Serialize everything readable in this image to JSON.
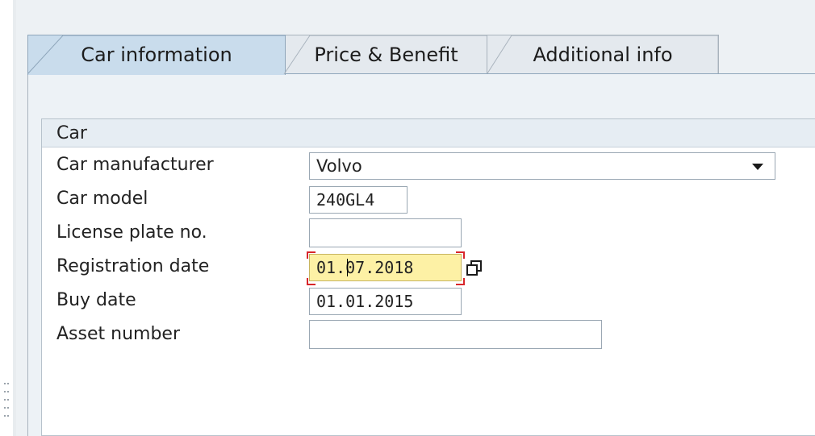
{
  "tabs": [
    {
      "label": "Car information",
      "active": true
    },
    {
      "label": "Price & Benefit",
      "active": false
    },
    {
      "label": "Additional info",
      "active": false
    }
  ],
  "group": {
    "title": "Car",
    "fields": {
      "car_manufacturer": {
        "label": "Car manufacturer",
        "value": "Volvo"
      },
      "car_model": {
        "label": "Car model",
        "value": "240GL4"
      },
      "license_plate": {
        "label": "License plate no.",
        "value": ""
      },
      "registration_date": {
        "label": "Registration date",
        "value": "01.07.2018"
      },
      "buy_date": {
        "label": "Buy date",
        "value": "01.01.2015"
      },
      "asset_number": {
        "label": "Asset number",
        "value": ""
      }
    }
  },
  "icons": {
    "dropdown": "chevron-down-icon",
    "calendar": "calendar-icon"
  },
  "colors": {
    "tab_active": "#c9dcec",
    "focus_field": "#fdf1a5",
    "focus_marker": "#d8262b"
  }
}
